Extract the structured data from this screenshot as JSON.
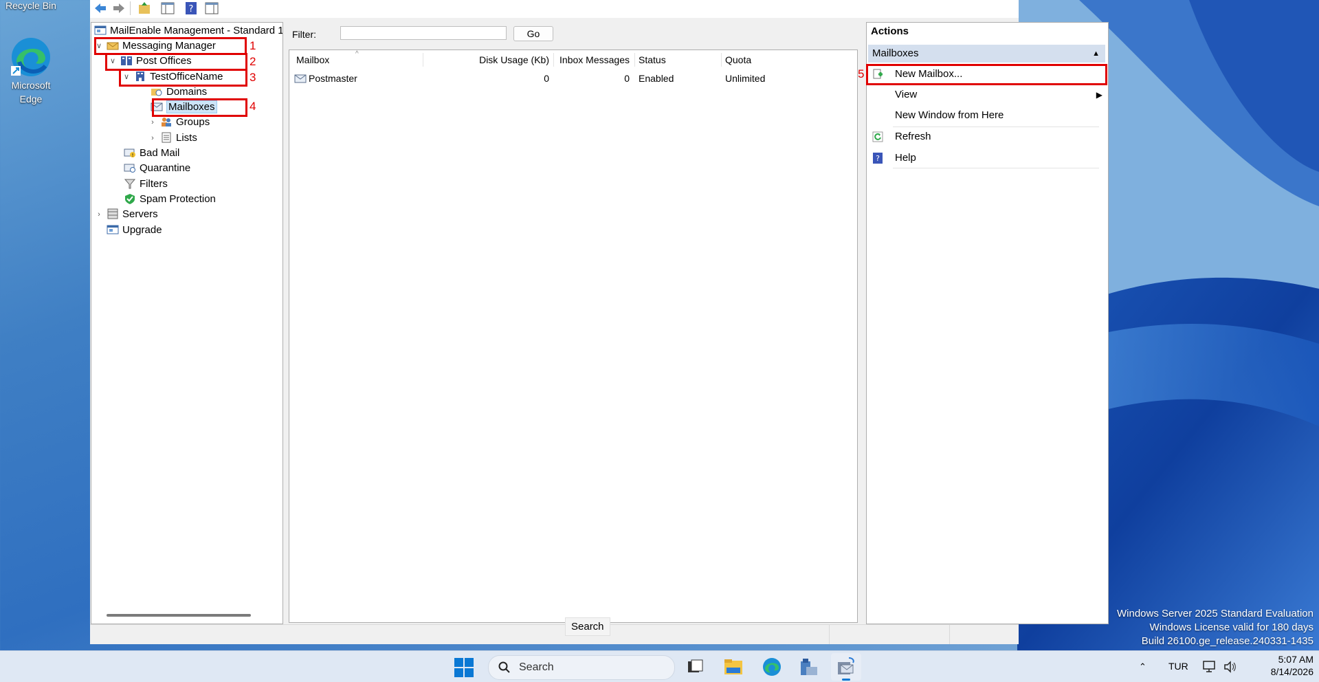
{
  "desktop": {
    "recycle_bin_label": "Recycle Bin",
    "edge_label": "Microsoft Edge"
  },
  "window": {
    "tree": {
      "root": "MailEnable Management - Standard 1",
      "items": [
        {
          "label": "Messaging Manager"
        },
        {
          "label": "Post Offices"
        },
        {
          "label": "TestOfficeName"
        },
        {
          "label": "Domains"
        },
        {
          "label": "Mailboxes"
        },
        {
          "label": "Groups"
        },
        {
          "label": "Lists"
        },
        {
          "label": "Bad Mail"
        },
        {
          "label": "Quarantine"
        },
        {
          "label": "Filters"
        },
        {
          "label": "Spam Protection"
        },
        {
          "label": "Servers"
        },
        {
          "label": "Upgrade"
        }
      ],
      "annotations": [
        "1",
        "2",
        "3",
        "4"
      ]
    },
    "center": {
      "filter_label": "Filter:",
      "filter_value": "",
      "go_label": "Go",
      "columns": [
        "Mailbox",
        "Disk Usage (Kb)",
        "Inbox Messages",
        "Status",
        "Quota"
      ],
      "rows": [
        {
          "mailbox": "Postmaster",
          "disk": "0",
          "inbox": "0",
          "status": "Enabled",
          "quota": "Unlimited"
        }
      ]
    },
    "actions": {
      "title": "Actions",
      "section": "Mailboxes",
      "items": [
        {
          "label": "New Mailbox..."
        },
        {
          "label": "View"
        },
        {
          "label": "New Window from Here"
        },
        {
          "label": "Refresh"
        },
        {
          "label": "Help"
        }
      ],
      "annotation": "5"
    }
  },
  "tooltip": "Search",
  "watermark": {
    "line1": "Windows Server 2025 Standard Evaluation",
    "line2": "Windows License valid for 180 days",
    "line3": "Build 26100.ge_release.240331-1435"
  },
  "taskbar": {
    "search_placeholder": "Search",
    "language": "TUR",
    "time": "5:07 AM",
    "date": "8/14/2026"
  }
}
